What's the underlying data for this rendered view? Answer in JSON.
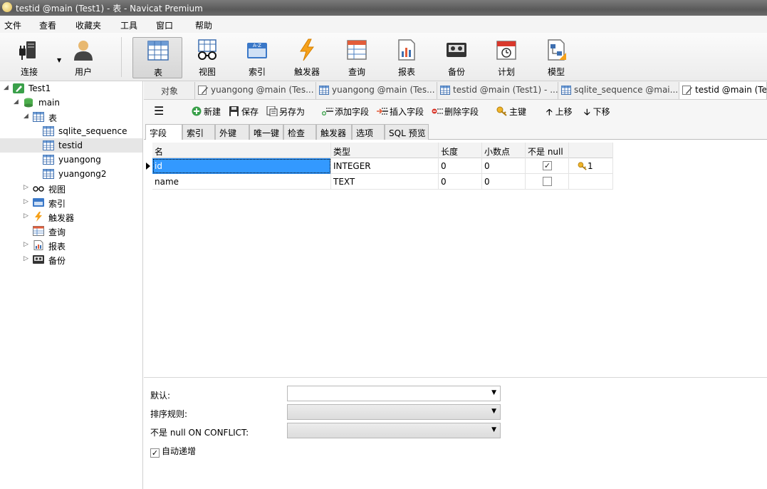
{
  "window": {
    "title": "testid @main (Test1) - 表 - Navicat Premium"
  },
  "menu": [
    "文件",
    "查看",
    "收藏夹",
    "工具",
    "窗口",
    "帮助"
  ],
  "toolbar": {
    "connect": "连接",
    "user": "用户",
    "items": [
      "表",
      "视图",
      "索引",
      "触发器",
      "查询",
      "报表",
      "备份",
      "计划",
      "模型"
    ],
    "active": "表"
  },
  "tree": {
    "connection": "Test1",
    "database": "main",
    "tables_group": "表",
    "tables": [
      "sqlite_sequence",
      "testid",
      "yuangong",
      "yuangong2"
    ],
    "selected_table": "testid",
    "groups": [
      "视图",
      "索引",
      "触发器",
      "查询",
      "报表",
      "备份"
    ]
  },
  "object_tabs": [
    "对象",
    "yuangong @main (Tes...",
    "yuangong @main (Tes...",
    "testid @main (Test1) - ...",
    "sqlite_sequence @mai...",
    "testid @main (Tes"
  ],
  "actions": {
    "new": "新建",
    "save": "保存",
    "save_as": "另存为",
    "add_field": "添加字段",
    "insert_field": "插入字段",
    "delete_field": "删除字段",
    "primary_key": "主键",
    "move_up": "上移",
    "move_down": "下移"
  },
  "sub_tabs": [
    "字段",
    "索引",
    "外键",
    "唯一键",
    "检查",
    "触发器",
    "选项",
    "SQL 预览"
  ],
  "fields": {
    "columns": [
      "名",
      "类型",
      "长度",
      "小数点",
      "不是 null"
    ],
    "rows": [
      {
        "name": "id",
        "type": "INTEGER",
        "length": "0",
        "decimals": "0",
        "not_null": true,
        "key": "1"
      },
      {
        "name": "name",
        "type": "TEXT",
        "length": "0",
        "decimals": "0",
        "not_null": false,
        "key": ""
      }
    ]
  },
  "properties": {
    "default_label": "默认:",
    "collation_label": "排序规则:",
    "notnull_conflict_label": "不是 null ON CONFLICT:",
    "autoincrement_label": "自动递增",
    "autoincrement_checked": true
  }
}
